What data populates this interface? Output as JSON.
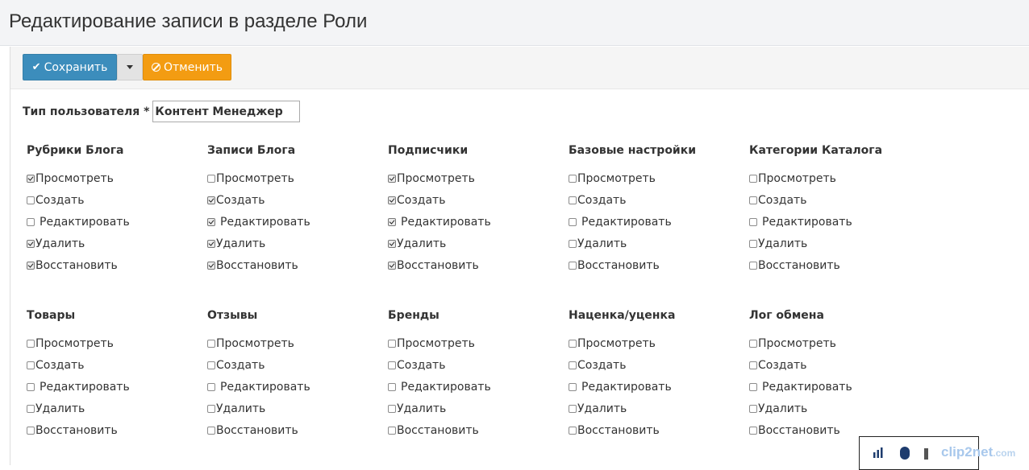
{
  "page": {
    "title": "Редактирование записи в разделе Роли"
  },
  "toolbar": {
    "save_label": "Сохранить",
    "cancel_label": "Отменить",
    "save_color": "#3c8dbc",
    "cancel_color": "#f39c12"
  },
  "user_type": {
    "label": "Тип пользователя",
    "required_mark": "*",
    "value": "Контент Менеджер"
  },
  "sections": [
    {
      "title": "Рубрики Блога",
      "perms": [
        {
          "label": "Просмотреть",
          "checked": true
        },
        {
          "label": "Создать",
          "checked": false
        },
        {
          "label": "Редактировать",
          "checked": false
        },
        {
          "label": "Удалить",
          "checked": true
        },
        {
          "label": "Восстановить",
          "checked": true
        }
      ]
    },
    {
      "title": "Записи Блога",
      "perms": [
        {
          "label": "Просмотреть",
          "checked": false
        },
        {
          "label": "Создать",
          "checked": true
        },
        {
          "label": "Редактировать",
          "checked": true
        },
        {
          "label": "Удалить",
          "checked": true
        },
        {
          "label": "Восстановить",
          "checked": true
        }
      ]
    },
    {
      "title": "Подписчики",
      "perms": [
        {
          "label": "Просмотреть",
          "checked": true
        },
        {
          "label": "Создать",
          "checked": true
        },
        {
          "label": "Редактировать",
          "checked": true
        },
        {
          "label": "Удалить",
          "checked": true
        },
        {
          "label": "Восстановить",
          "checked": true
        }
      ]
    },
    {
      "title": "Базовые настройки",
      "perms": [
        {
          "label": "Просмотреть",
          "checked": false
        },
        {
          "label": "Создать",
          "checked": false
        },
        {
          "label": "Редактировать",
          "checked": false
        },
        {
          "label": "Удалить",
          "checked": false
        },
        {
          "label": "Восстановить",
          "checked": false
        }
      ]
    },
    {
      "title": "Категории Каталога",
      "perms": [
        {
          "label": "Просмотреть",
          "checked": false
        },
        {
          "label": "Создать",
          "checked": false
        },
        {
          "label": "Редактировать",
          "checked": false
        },
        {
          "label": "Удалить",
          "checked": false
        },
        {
          "label": "Восстановить",
          "checked": false
        }
      ]
    },
    {
      "title": "Товары",
      "perms": [
        {
          "label": "Просмотреть",
          "checked": false
        },
        {
          "label": "Создать",
          "checked": false
        },
        {
          "label": "Редактировать",
          "checked": false
        },
        {
          "label": "Удалить",
          "checked": false
        },
        {
          "label": "Восстановить",
          "checked": false
        }
      ]
    },
    {
      "title": "Отзывы",
      "perms": [
        {
          "label": "Просмотреть",
          "checked": false
        },
        {
          "label": "Создать",
          "checked": false
        },
        {
          "label": "Редактировать",
          "checked": false
        },
        {
          "label": "Удалить",
          "checked": false
        },
        {
          "label": "Восстановить",
          "checked": false
        }
      ]
    },
    {
      "title": "Бренды",
      "perms": [
        {
          "label": "Просмотреть",
          "checked": false
        },
        {
          "label": "Создать",
          "checked": false
        },
        {
          "label": "Редактировать",
          "checked": false
        },
        {
          "label": "Удалить",
          "checked": false
        },
        {
          "label": "Восстановить",
          "checked": false
        }
      ]
    },
    {
      "title": "Наценка/уценка",
      "perms": [
        {
          "label": "Просмотреть",
          "checked": false
        },
        {
          "label": "Создать",
          "checked": false
        },
        {
          "label": "Редактировать",
          "checked": false
        },
        {
          "label": "Удалить",
          "checked": false
        },
        {
          "label": "Восстановить",
          "checked": false
        }
      ]
    },
    {
      "title": "Лог обмена",
      "perms": [
        {
          "label": "Просмотреть",
          "checked": false
        },
        {
          "label": "Создать",
          "checked": false
        },
        {
          "label": "Редактировать",
          "checked": false
        },
        {
          "label": "Удалить",
          "checked": false
        },
        {
          "label": "Восстановить",
          "checked": false
        }
      ]
    }
  ],
  "overlay": {
    "brand": "clip2net",
    "brand_tld": ".com",
    "icons": [
      "network-icon",
      "bluetooth-icon",
      "device-icon"
    ]
  }
}
